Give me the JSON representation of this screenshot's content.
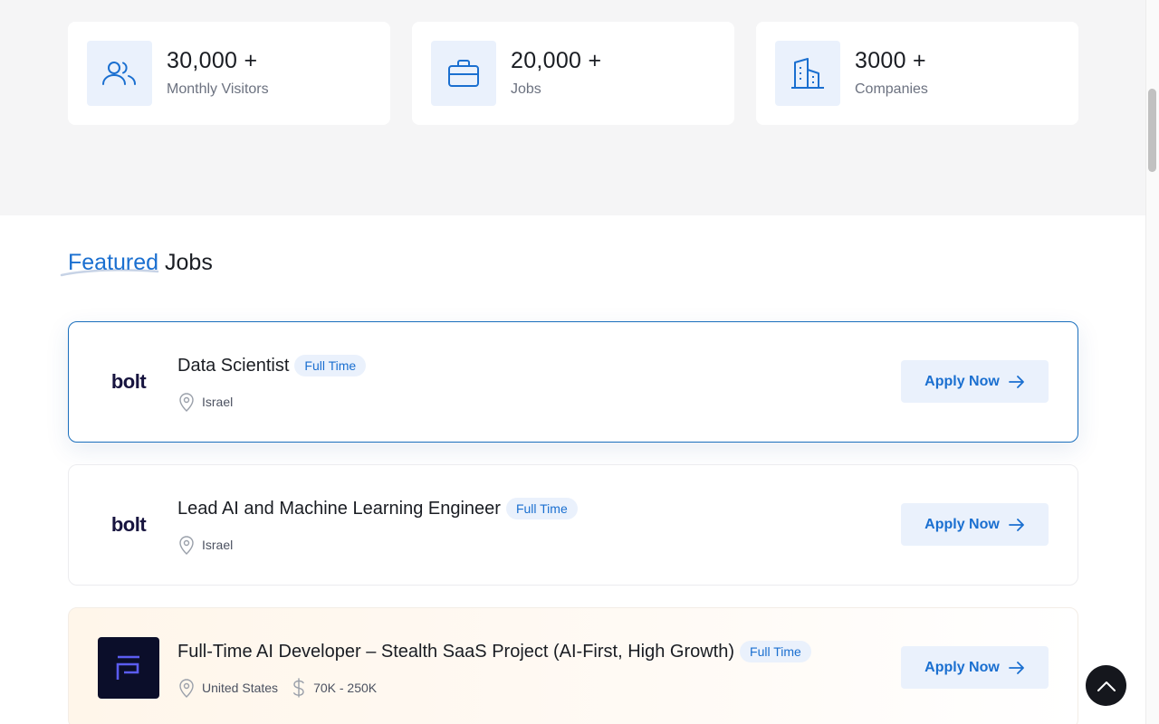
{
  "stats": [
    {
      "value": "30,000 +",
      "label": "Monthly Visitors",
      "icon": "users-icon"
    },
    {
      "value": "20,000 +",
      "label": "Jobs",
      "icon": "briefcase-icon"
    },
    {
      "value": "3000 +",
      "label": "Companies",
      "icon": "building-icon"
    }
  ],
  "featured": {
    "title_accent": "Featured",
    "title_rest": "Jobs"
  },
  "jobs": [
    {
      "logo_text": "bolt",
      "title": "Data Scientist",
      "type": "Full Time",
      "location": "Israel",
      "salary": "",
      "apply_label": "Apply Now"
    },
    {
      "logo_text": "bolt",
      "title": "Lead AI and Machine Learning Engineer",
      "type": "Full Time",
      "location": "Israel",
      "salary": "",
      "apply_label": "Apply Now"
    },
    {
      "logo_text": "",
      "title": "Full-Time AI Developer – Stealth SaaS Project (AI-First, High Growth)",
      "type": "Full Time",
      "location": "United States",
      "salary": "70K - 250K",
      "apply_label": "Apply Now"
    }
  ],
  "colors": {
    "accent": "#1a6fd0",
    "accent_bg": "#eaf1fc",
    "text": "#1a1d23",
    "muted": "#6c7280",
    "dark_logo_bg": "#0b0e2a"
  }
}
